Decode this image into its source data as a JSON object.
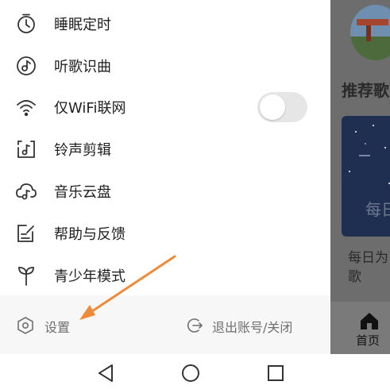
{
  "menu": {
    "items": [
      {
        "label": "睡眠定时",
        "icon": "timer-icon"
      },
      {
        "label": "听歌识曲",
        "icon": "music-recognition-icon"
      },
      {
        "label": "仅WiFi联网",
        "icon": "wifi-icon",
        "toggle": false
      },
      {
        "label": "铃声剪辑",
        "icon": "ringtone-edit-icon"
      },
      {
        "label": "音乐云盘",
        "icon": "cloud-music-icon"
      },
      {
        "label": "帮助与反馈",
        "icon": "help-feedback-icon"
      },
      {
        "label": "青少年模式",
        "icon": "youth-mode-icon"
      }
    ]
  },
  "footer": {
    "settings_label": "设置",
    "logout_label": "退出账号/关闭"
  },
  "background": {
    "section_heading": "推荐歌",
    "card_overlay_text": "每日",
    "card_title": "每日为歌",
    "tab_home_label": "首页"
  },
  "colors": {
    "annotation_arrow": "#ee8a3a",
    "footer_bg": "#f7f7f7",
    "text": "#1f1f1f",
    "muted_text": "#6f6f6f"
  }
}
